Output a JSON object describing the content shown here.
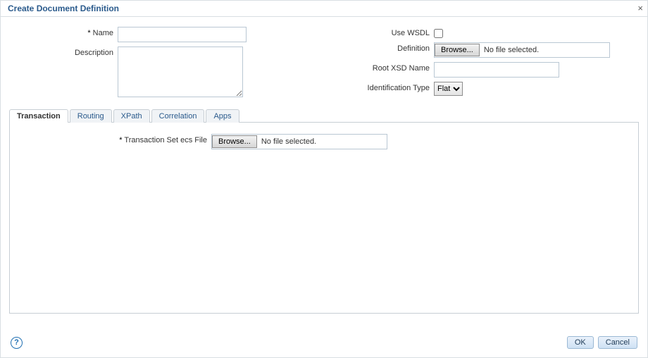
{
  "dialog": {
    "title": "Create Document Definition"
  },
  "left": {
    "name_label": "Name",
    "name_value": "",
    "description_label": "Description",
    "description_value": ""
  },
  "right": {
    "use_wsdl_label": "Use WSDL",
    "use_wsdl_checked": false,
    "definition_label": "Definition",
    "definition_browse": "Browse...",
    "definition_status": "No file selected.",
    "root_xsd_label": "Root XSD Name",
    "root_xsd_value": "",
    "ident_type_label": "Identification Type",
    "ident_type_value": "Flat"
  },
  "tabs": [
    {
      "label": "Transaction",
      "active": true
    },
    {
      "label": "Routing",
      "active": false
    },
    {
      "label": "XPath",
      "active": false
    },
    {
      "label": "Correlation",
      "active": false
    },
    {
      "label": "Apps",
      "active": false
    }
  ],
  "transaction_panel": {
    "ecs_label": "Transaction Set ecs File",
    "ecs_browse": "Browse...",
    "ecs_status": "No file selected."
  },
  "footer": {
    "help": "?",
    "ok": "OK",
    "cancel": "Cancel"
  }
}
